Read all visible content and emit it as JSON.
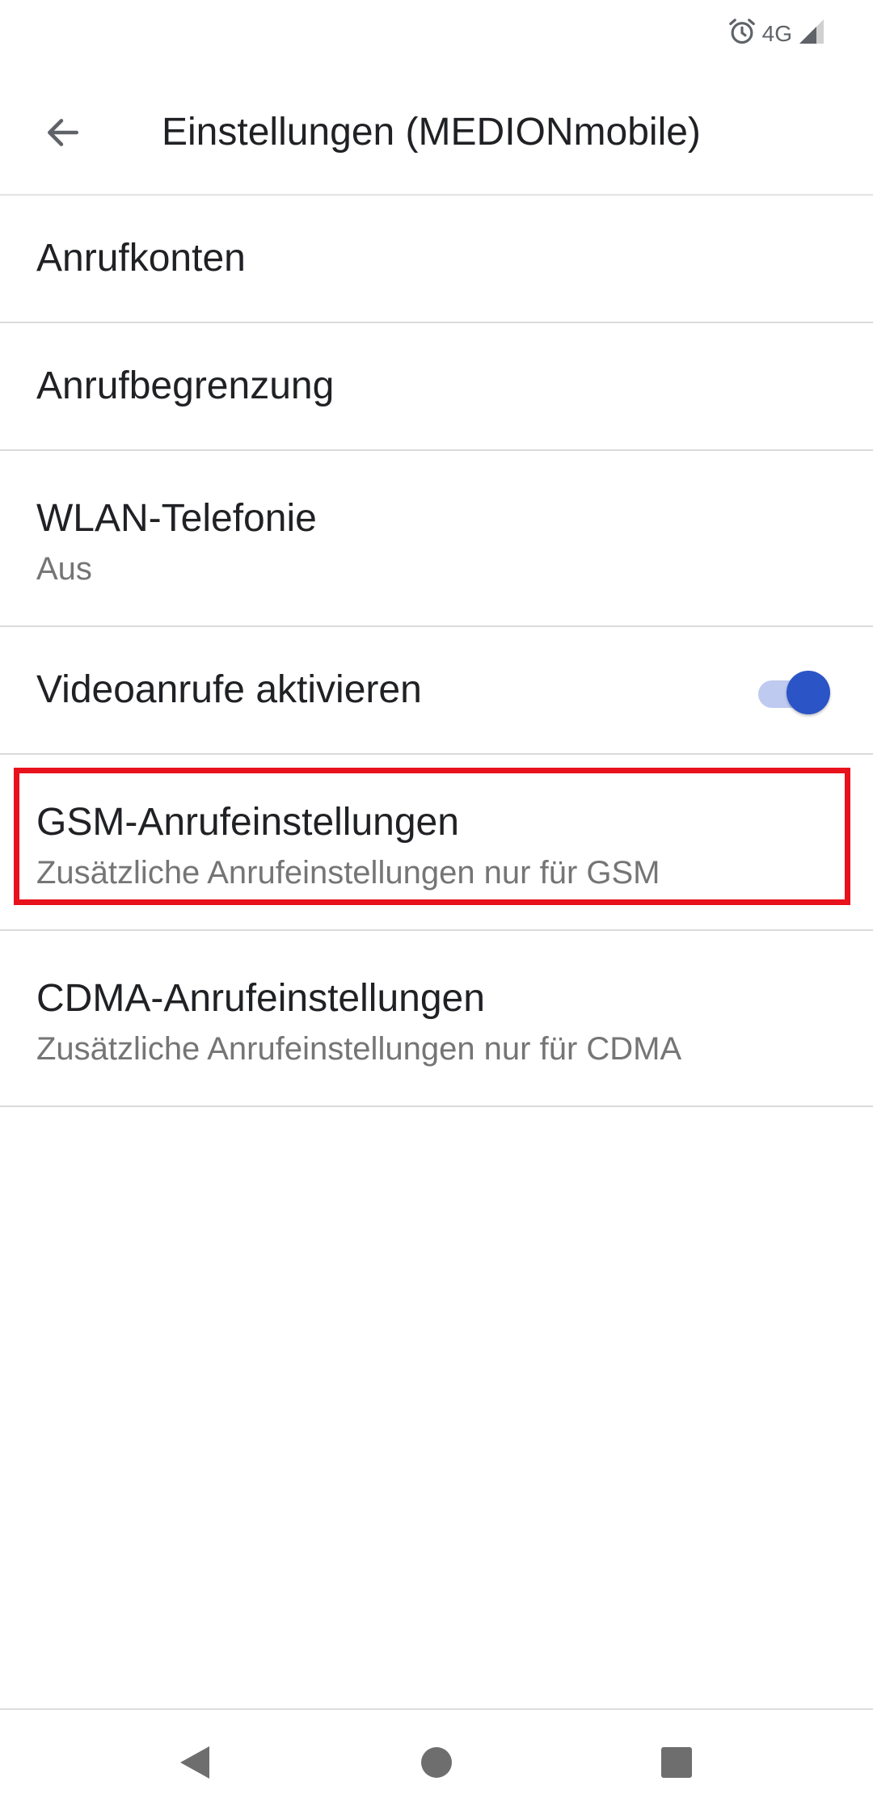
{
  "status_bar": {
    "network_type": "4G",
    "icons": [
      "alarm-icon",
      "signal-icon"
    ]
  },
  "app_bar": {
    "back_icon": "arrow-left-icon",
    "title": "Einstellungen (MEDIONmobile)"
  },
  "settings": {
    "items": [
      {
        "title": "Anrufkonten"
      },
      {
        "title": "Anrufbegrenzung"
      },
      {
        "title": "WLAN-Telefonie",
        "subtitle": "Aus"
      },
      {
        "title": "Videoanrufe aktivieren",
        "toggle": true
      },
      {
        "title": "GSM-Anrufeinstellungen",
        "subtitle": "Zusätzliche Anrufeinstellungen nur für GSM",
        "highlighted": true
      },
      {
        "title": "CDMA-Anrufeinstellungen",
        "subtitle": "Zusätzliche Anrufeinstellungen nur für CDMA"
      }
    ]
  },
  "nav_bar": {
    "icons": [
      "back-triangle-icon",
      "home-circle-icon",
      "recents-square-icon"
    ]
  },
  "colors": {
    "accent": "#2b54c7",
    "toggle_track": "#bfcaf0",
    "highlight": "#e8121c",
    "secondary_text": "#757575",
    "icon_gray": "#5f6368"
  }
}
